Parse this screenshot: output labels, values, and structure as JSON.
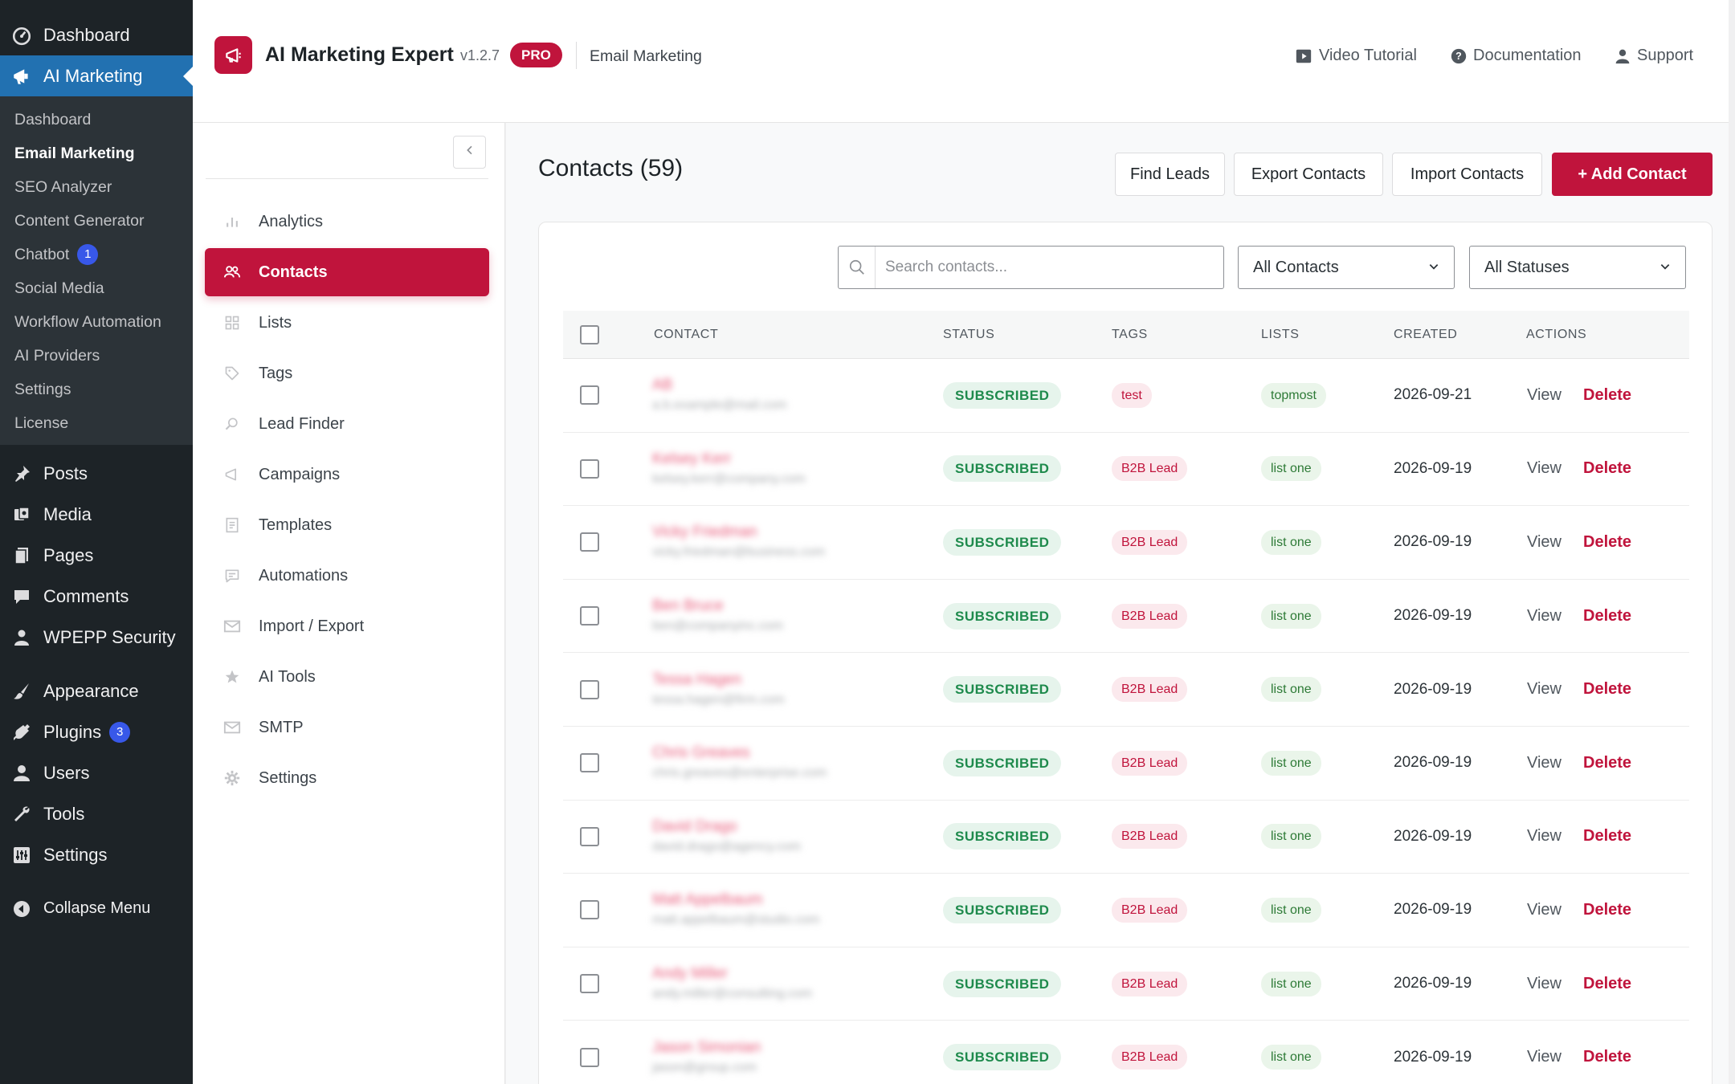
{
  "wp_menu": {
    "top": [
      {
        "label": "Dashboard",
        "icon": "dashboard-icon"
      },
      {
        "label": "AI Marketing",
        "icon": "megaphone-icon"
      }
    ],
    "submenu": [
      {
        "label": "Dashboard"
      },
      {
        "label": "Email Marketing"
      },
      {
        "label": "SEO Analyzer"
      },
      {
        "label": "Content Generator"
      },
      {
        "label": "Chatbot",
        "badge": "1"
      },
      {
        "label": "Social Media"
      },
      {
        "label": "Workflow Automation"
      },
      {
        "label": "AI Providers"
      },
      {
        "label": "Settings"
      },
      {
        "label": "License"
      }
    ],
    "items": [
      {
        "label": "Posts",
        "icon": "pin-icon"
      },
      {
        "label": "Media",
        "icon": "media-icon"
      },
      {
        "label": "Pages",
        "icon": "pages-icon"
      },
      {
        "label": "Comments",
        "icon": "comment-icon"
      },
      {
        "label": "WPEPP Security",
        "icon": "lock-icon"
      },
      {
        "label": "Appearance",
        "icon": "brush-icon"
      },
      {
        "label": "Plugins",
        "icon": "plug-icon",
        "badge": "3"
      },
      {
        "label": "Users",
        "icon": "user-icon"
      },
      {
        "label": "Tools",
        "icon": "wrench-icon"
      },
      {
        "label": "Settings",
        "icon": "sliders-icon"
      },
      {
        "label": "Collapse Menu",
        "icon": "collapse-icon"
      }
    ]
  },
  "header": {
    "title": "AI Marketing Expert",
    "version": "v1.2.7",
    "pro": "PRO",
    "section": "Email Marketing",
    "links": {
      "video": "Video Tutorial",
      "docs": "Documentation",
      "support": "Support"
    }
  },
  "plugin_nav": [
    {
      "label": "Analytics",
      "icon": "bar-chart-icon"
    },
    {
      "label": "Contacts",
      "icon": "users-icon"
    },
    {
      "label": "Lists",
      "icon": "grid-icon"
    },
    {
      "label": "Tags",
      "icon": "tag-icon"
    },
    {
      "label": "Lead Finder",
      "icon": "search-icon"
    },
    {
      "label": "Campaigns",
      "icon": "megaphone-icon"
    },
    {
      "label": "Templates",
      "icon": "document-icon"
    },
    {
      "label": "Automations",
      "icon": "message-icon"
    },
    {
      "label": "Import / Export",
      "icon": "mail-icon"
    },
    {
      "label": "AI Tools",
      "icon": "star-icon"
    },
    {
      "label": "SMTP",
      "icon": "envelope-icon"
    },
    {
      "label": "Settings",
      "icon": "gear-icon"
    }
  ],
  "main": {
    "title": "Contacts (59)",
    "buttons": {
      "find_leads": "Find Leads",
      "export": "Export Contacts",
      "import": "Import Contacts",
      "add": "+ Add Contact"
    },
    "search_placeholder": "Search contacts...",
    "filter_contacts": "All Contacts",
    "filter_status": "All Statuses",
    "columns": {
      "contact": "CONTACT",
      "status": "STATUS",
      "tags": "TAGS",
      "lists": "LISTS",
      "created": "CREATED",
      "actions": "ACTIONS"
    },
    "actions": {
      "view": "View",
      "delete": "Delete"
    },
    "rows": [
      {
        "name": "AB",
        "email": "a.b.example@mail.com",
        "status": "SUBSCRIBED",
        "tag": "test",
        "list": "topmost",
        "created": "2026-09-21"
      },
      {
        "name": "Kelsey Kerr",
        "email": "kelsey.kerr@company.com",
        "status": "SUBSCRIBED",
        "tag": "B2B Lead",
        "list": "list one",
        "created": "2026-09-19"
      },
      {
        "name": "Vicky Friedman",
        "email": "vicky.friedman@business.com",
        "status": "SUBSCRIBED",
        "tag": "B2B Lead",
        "list": "list one",
        "created": "2026-09-19"
      },
      {
        "name": "Ben Bruce",
        "email": "ben@companyinc.com",
        "status": "SUBSCRIBED",
        "tag": "B2B Lead",
        "list": "list one",
        "created": "2026-09-19"
      },
      {
        "name": "Tessa Hagen",
        "email": "tessa.hagen@firm.com",
        "status": "SUBSCRIBED",
        "tag": "B2B Lead",
        "list": "list one",
        "created": "2026-09-19"
      },
      {
        "name": "Chris Greaves",
        "email": "chris.greaves@enterprise.com",
        "status": "SUBSCRIBED",
        "tag": "B2B Lead",
        "list": "list one",
        "created": "2026-09-19"
      },
      {
        "name": "David Drago",
        "email": "david.drago@agency.com",
        "status": "SUBSCRIBED",
        "tag": "B2B Lead",
        "list": "list one",
        "created": "2026-09-19"
      },
      {
        "name": "Matt Appelbaum",
        "email": "matt.appelbaum@studio.com",
        "status": "SUBSCRIBED",
        "tag": "B2B Lead",
        "list": "list one",
        "created": "2026-09-19"
      },
      {
        "name": "Andy Miller",
        "email": "andy.miller@consulting.com",
        "status": "SUBSCRIBED",
        "tag": "B2B Lead",
        "list": "list one",
        "created": "2026-09-19"
      },
      {
        "name": "Jason Simonian",
        "email": "jason@group.com",
        "status": "SUBSCRIBED",
        "tag": "B2B Lead",
        "list": "list one",
        "created": "2026-09-19"
      }
    ]
  }
}
